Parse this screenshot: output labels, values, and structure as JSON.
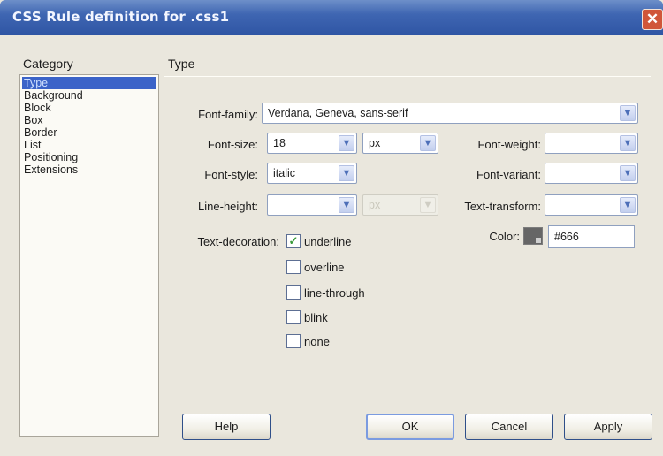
{
  "window": {
    "title": "CSS Rule definition for .css1",
    "close_glyph": "✕"
  },
  "category": {
    "label": "Category",
    "items": [
      "Type",
      "Background",
      "Block",
      "Box",
      "Border",
      "List",
      "Positioning",
      "Extensions"
    ],
    "selected": "Type"
  },
  "section": {
    "title": "Type"
  },
  "fields": {
    "font_family": {
      "label": "Font-family:",
      "value": "Verdana, Geneva, sans-serif"
    },
    "font_size": {
      "label": "Font-size:",
      "value": "18",
      "unit": "px"
    },
    "font_weight": {
      "label": "Font-weight:",
      "value": ""
    },
    "font_style": {
      "label": "Font-style:",
      "value": "italic"
    },
    "font_variant": {
      "label": "Font-variant:",
      "value": ""
    },
    "line_height": {
      "label": "Line-height:",
      "value": "",
      "unit": "px"
    },
    "text_transform": {
      "label": "Text-transform:",
      "value": ""
    },
    "color": {
      "label": "Color:",
      "value": "#666",
      "swatch": "#666666"
    },
    "text_decoration": {
      "label": "Text-decoration:",
      "options": [
        {
          "label": "underline",
          "checked": true
        },
        {
          "label": "overline",
          "checked": false
        },
        {
          "label": "line-through",
          "checked": false
        },
        {
          "label": "blink",
          "checked": false
        },
        {
          "label": "none",
          "checked": false
        }
      ]
    }
  },
  "buttons": {
    "help": "Help",
    "ok": "OK",
    "cancel": "Cancel",
    "apply": "Apply"
  },
  "icons": {
    "dropdown": "chevron-down-icon",
    "check": "✓"
  }
}
